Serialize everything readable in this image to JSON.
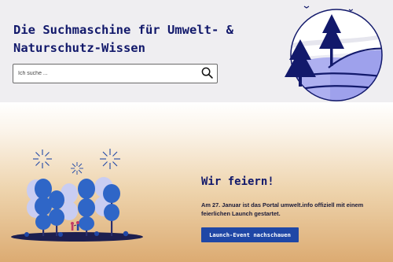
{
  "header": {
    "headline": "Die Suchmaschine für Umwelt- & Naturschutz-Wissen"
  },
  "search": {
    "placeholder": "Ich suche ...",
    "button_icon": "search-icon"
  },
  "logo": {
    "icon": "forest-landscape-logo"
  },
  "banner": {
    "title": "Wir feiern!",
    "text": "Am 27. Januar ist das Portal umwelt.info offiziell mit einem feierlichen Launch gestartet.",
    "cta_label": "Launch-Event nachschauen",
    "illustration_icon": "celebration-trees-fireworks-illustration"
  },
  "colors": {
    "navy": "#12196b",
    "accent_blue": "#1f47a6",
    "lavender": "#aeb0f0",
    "hero_bg": "#efeef1",
    "banner_gold": "#dcab72"
  }
}
